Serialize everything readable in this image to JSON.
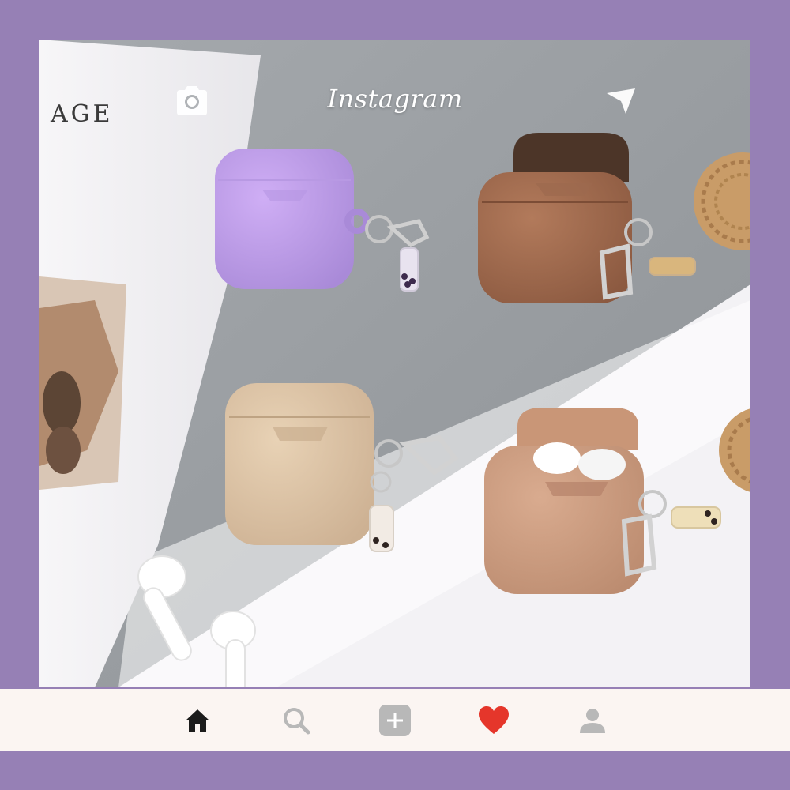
{
  "app": {
    "title": "Instagram"
  },
  "post": {
    "magazine_text": "AGE"
  },
  "icons": {
    "camera": "camera-icon",
    "send": "send-icon",
    "home": "home-icon",
    "search": "search-icon",
    "add": "add-post-icon",
    "heart": "heart-icon",
    "profile": "profile-icon"
  },
  "colors": {
    "frame": "#9680b5",
    "nav_background": "#fbf5f2",
    "heart": "#e5362b",
    "active_icon": "#1c1c1c",
    "inactive_icon": "#b8b8b8"
  }
}
